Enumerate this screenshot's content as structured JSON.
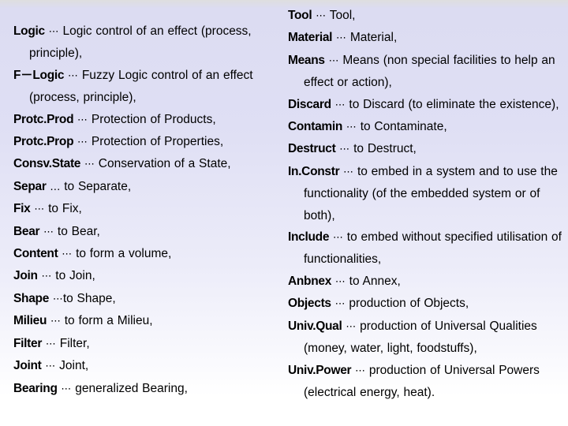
{
  "slide": {
    "type": "glossary-slide",
    "background": {
      "gradient_from": "#dcdcf2",
      "gradient_to": "#ffffff",
      "direction": "vertical"
    },
    "text_color": "#000000"
  },
  "columns": [
    {
      "name": "left-column",
      "entries": [
        {
          "term": "Logic",
          "sep": "⋯",
          "definition": "Logic control of an effect (process, principle),"
        },
        {
          "term": "F－Logic",
          "sep": "⋯",
          "definition": "Fuzzy Logic control of an effect (process, principle),"
        },
        {
          "term": "Protc.Prod",
          "sep": "⋯",
          "definition": "Protection of  Products,"
        },
        {
          "term": "Protc.Prop",
          "sep": "⋯",
          "definition": "Protection of Properties,"
        },
        {
          "term": "Consv.State",
          "sep": "⋯",
          "definition": "Conservation of  a State,"
        },
        {
          "term": "Separ",
          "sep": "…",
          "definition": "to Separate,"
        },
        {
          "term": "Fix",
          "sep": "⋯",
          "definition": "to Fix,"
        },
        {
          "term": "Bear",
          "sep": "⋯",
          "definition": "to Bear,"
        },
        {
          "term": "Content",
          "sep": "⋯",
          "definition": "to form a volume,"
        },
        {
          "term": "Join",
          "sep": "⋯",
          "definition": "to Join,"
        },
        {
          "term": "Shape",
          "sep": "⋯",
          "definition": "to Shape,",
          "no_space_after_sep": true
        },
        {
          "term": "Milieu",
          "sep": "⋯",
          "definition": "to form a Milieu,"
        },
        {
          "term": "Filter",
          "sep": "⋯",
          "definition": "Filter,"
        },
        {
          "term": "Joint",
          "sep": "⋯",
          "definition": "Joint,"
        },
        {
          "term": "Bearing",
          "sep": "⋯",
          "definition": "generalized  Bearing,"
        }
      ]
    },
    {
      "name": "right-column",
      "entries": [
        {
          "term": "Tool",
          "sep": "⋯",
          "definition": "Tool,"
        },
        {
          "term": "Material",
          "sep": "⋯",
          "definition": "Material,"
        },
        {
          "term": "Means",
          "sep": "⋯",
          "definition": "Means (non special facilities  to help an effect or action),"
        },
        {
          "term": "Discard",
          "sep": "⋯",
          "definition": "to Discard (to eliminate the existence),"
        },
        {
          "term": "Contamin",
          "sep": "⋯",
          "definition": "to Contaminate,"
        },
        {
          "term": "Destruct",
          "sep": "⋯",
          "definition": "to Destruct,"
        },
        {
          "term": "In.Constr",
          "sep": "⋯",
          "definition": "to embed in a system and to use the functionality (of the embedded system or of both),"
        },
        {
          "term": "Include",
          "sep": "⋯",
          "definition": "to embed without specified utilisation of functionalities,"
        },
        {
          "term": "Anbnex",
          "sep": "⋯",
          "definition": "to Annex,"
        },
        {
          "term": "Objects",
          "sep": "⋯",
          "definition": "production of Objects,"
        },
        {
          "term": "Univ.Qual",
          "sep": "⋯",
          "definition": "production of Universal Qualities (money, water, light, foodstuffs),"
        },
        {
          "term": "Univ.Power",
          "sep": "⋯",
          "definition": "production of Universal Powers (electrical energy, heat)."
        }
      ]
    }
  ]
}
